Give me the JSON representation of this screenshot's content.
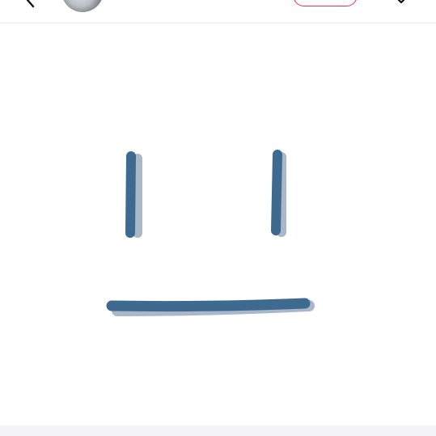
{
  "header": {
    "back_icon": "chevron-left-icon",
    "avatar_icon": "avatar",
    "more_icon": "chevron-down-icon",
    "follow_button_color": "#ee2a55"
  },
  "drawing": {
    "subject": "",
    "stroke_color": "#3f6a8f",
    "shadow_color": "#a9b7c9"
  }
}
